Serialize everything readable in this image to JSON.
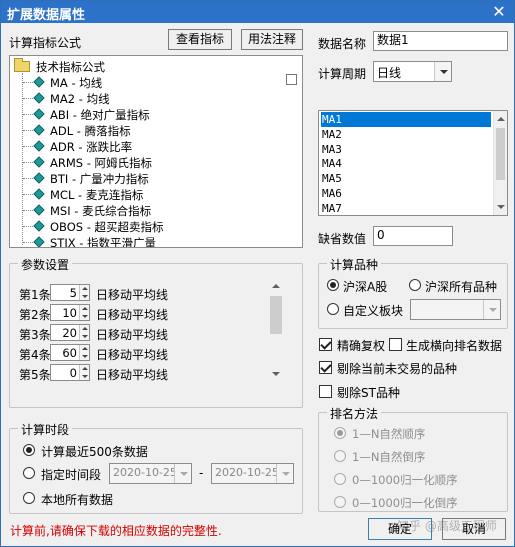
{
  "window": {
    "title": "扩展数据属性",
    "close_glyph": "✕"
  },
  "formula": {
    "label": "计算指标公式",
    "view_button": "查看指标",
    "usage_button": "用法注释",
    "tree_root": "技术指标公式",
    "items": [
      "MA - 均线",
      "MA2 - 均线",
      "ABI - 绝对广量指标",
      "ADL - 腾落指标",
      "ADR - 涨跌比率",
      "ARMS - 阿姆氏指标",
      "BTI - 广量冲力指标",
      "MCL - 麦克连指标",
      "MSI - 麦氏综合指标",
      "OBOS - 超买超卖指标",
      "STIX - 指数平滑广量"
    ]
  },
  "data_name": {
    "label": "数据名称",
    "value": "数据1"
  },
  "period": {
    "label": "计算周期",
    "value": "日线"
  },
  "ma_list": {
    "items": [
      "MA1",
      "MA2",
      "MA3",
      "MA4",
      "MA5",
      "MA6",
      "MA7"
    ],
    "selected_index": 0
  },
  "default_value": {
    "label": "缺省数值",
    "value": "0"
  },
  "params": {
    "title": "参数设置",
    "rows": [
      {
        "label": "第1条",
        "value": "5",
        "desc": "日移动平均线"
      },
      {
        "label": "第2条",
        "value": "10",
        "desc": "日移动平均线"
      },
      {
        "label": "第3条",
        "value": "20",
        "desc": "日移动平均线"
      },
      {
        "label": "第4条",
        "value": "60",
        "desc": "日移动平均线"
      },
      {
        "label": "第5条",
        "value": "0",
        "desc": "日移动平均线"
      }
    ]
  },
  "calc_time": {
    "title": "计算时段",
    "opt_recent": "计算最近500条数据",
    "opt_range": "指定时间段",
    "start_date": "2020-10-25",
    "dash": "-",
    "end_date": "2020-10-25",
    "opt_all": "本地所有数据",
    "selected": "recent"
  },
  "variety": {
    "title": "计算品种",
    "opt_a": "沪深A股",
    "opt_all": "沪深所有品种",
    "opt_custom": "自定义板块",
    "selected": "a"
  },
  "checks": {
    "exact_rights": {
      "label": "精确复权",
      "checked": true
    },
    "gen_rank": {
      "label": "生成横向排名数据",
      "checked": false
    },
    "exclude_untraded": {
      "label": "剔除当前未交易的品种",
      "checked": true
    },
    "exclude_st": {
      "label": "剔除ST品种",
      "checked": false
    }
  },
  "sort": {
    "title": "排名方法",
    "options": [
      "1—N自然顺序",
      "1—N自然倒序",
      "0—1000归一化顺序",
      "0—1000归一化倒序"
    ],
    "selected_index": 0
  },
  "footer": {
    "warning": "计算前,请确保下载的相应数据的完整性.",
    "ok_button": "确定",
    "cancel_button": "取消",
    "watermark": "知乎 @高级工程师"
  },
  "colors": {
    "title_bar": "#2d72c9",
    "selection": "#0078d7",
    "warning": "#d40000"
  }
}
